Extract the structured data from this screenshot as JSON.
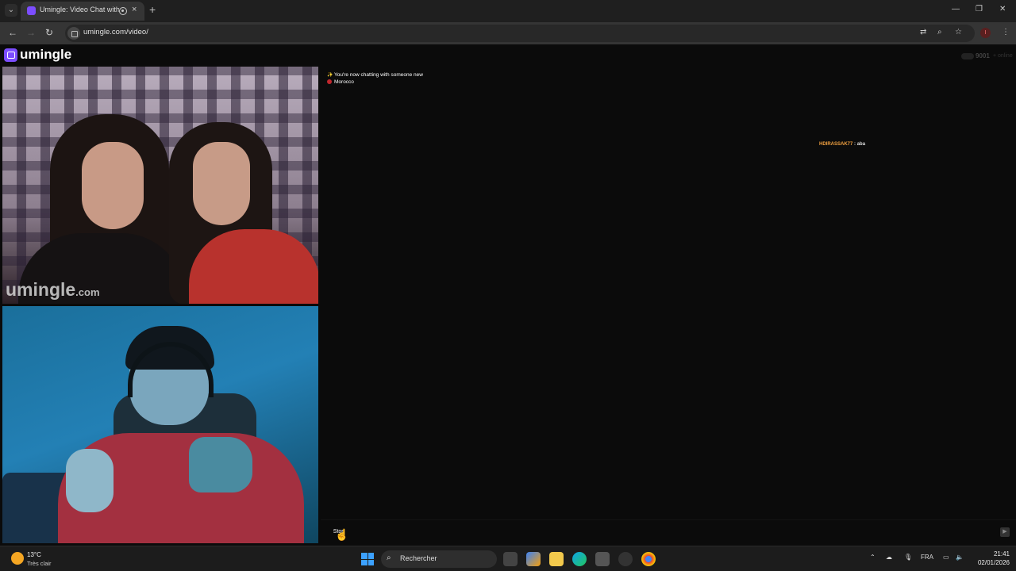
{
  "browser": {
    "tab_title": "Umingle: Video Chat with S",
    "tab_close": "×",
    "new_tab": "+",
    "url": "umingle.com/video/",
    "window_controls": {
      "minimize": "—",
      "restore": "❐",
      "close": "✕"
    },
    "nav": {
      "back": "←",
      "forward": "→",
      "reload": "↻"
    },
    "profile_initial": "I"
  },
  "site": {
    "logo": "umingle",
    "online_count": "9001",
    "online_label": "+ online"
  },
  "remote_video": {
    "watermark_main": "umingle",
    "watermark_suffix": ".com"
  },
  "chat": {
    "system_messages": [
      {
        "icon": "sparkle-icon",
        "text": "You're now chatting with someone new"
      },
      {
        "icon": "morocco-flag-icon",
        "text": "Morocco"
      }
    ],
    "messages": [
      {
        "user": "HDIRASSAK77",
        "separator": " : ",
        "text": "aba"
      }
    ],
    "stop_label": "Stop",
    "input_value": "",
    "send_icon": "send-icon"
  },
  "taskbar": {
    "temperature": "13°C",
    "condition": "Très clair",
    "search_placeholder": "Rechercher",
    "language": "FRA",
    "time": "21:41",
    "date": "02/01/2026"
  },
  "colors": {
    "brand": "#7c4dff",
    "chat_username": "#f0a040",
    "background": "#0b0b0b"
  }
}
